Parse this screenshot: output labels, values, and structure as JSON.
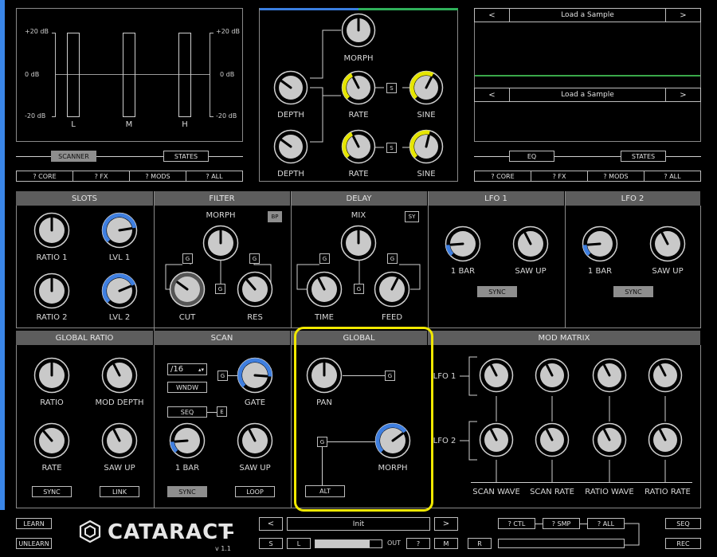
{
  "colors": {
    "accent_blue": "#3f7fe0",
    "accent_yellow": "#e6e600",
    "knob_fill": "#c9c9c9",
    "highlight": "#f0e800",
    "edge_bar": "#3a86e8",
    "scope_line": "#3aa84a"
  },
  "meters": {
    "scale_left": [
      "+20 dB",
      "0 dB",
      "-20 dB"
    ],
    "scale_right": [
      "+20 dB",
      "0 dB",
      "-20 dB"
    ],
    "bands": [
      "L",
      "M",
      "H"
    ],
    "tabs": {
      "scanner": "SCANNER",
      "states": "STATES"
    },
    "help": [
      "? CORE",
      "? FX",
      "? MODS",
      "? ALL"
    ]
  },
  "mod": {
    "labels": {
      "morph": "MORPH",
      "depth": "DEPTH",
      "rate": "RATE",
      "sine": "SINE",
      "s": "S"
    },
    "knobs": {
      "morph": 0.5,
      "depth1": 0.3,
      "rate1": 0.4,
      "sine1": 0.6,
      "depth2": 0.3,
      "rate2": 0.4,
      "sine2": 0.55
    }
  },
  "sampler": {
    "prev": "<",
    "next": ">",
    "slot1": "Load a Sample",
    "slot2": "Load a Sample",
    "tabs": {
      "eq": "EQ",
      "states": "STATES"
    },
    "help": [
      "? CORE",
      "? FX",
      "? MODS",
      "? ALL"
    ]
  },
  "slots": {
    "header": "SLOTS",
    "ratio1": "RATIO 1",
    "lvl1": "LVL 1",
    "ratio2": "RATIO 2",
    "lvl2": "LVL 2",
    "knobs": {
      "ratio1": 0.5,
      "lvl1": 0.8,
      "ratio2": 0.5,
      "lvl2": 0.75
    }
  },
  "filter": {
    "header": "FILTER",
    "morph": "MORPH",
    "bp": "BP",
    "cut": "CUT",
    "res": "RES",
    "g": "G",
    "knobs": {
      "morph": 0.5,
      "cut": 0.3,
      "res": 0.35
    }
  },
  "delay": {
    "header": "DELAY",
    "mix": "MIX",
    "sy": "SY",
    "time": "TIME",
    "feed": "FEED",
    "g": "G",
    "knobs": {
      "mix": 0.5,
      "time": 0.4,
      "feed": 0.6
    }
  },
  "lfo1": {
    "header": "LFO 1",
    "bar": "1 BAR",
    "saw": "SAW UP",
    "sync": "SYNC",
    "knobs": {
      "bar": 0.15,
      "saw": 0.4
    }
  },
  "lfo2": {
    "header": "LFO 2",
    "bar": "1 BAR",
    "saw": "SAW UP",
    "sync": "SYNC",
    "knobs": {
      "bar": 0.15,
      "saw": 0.4
    }
  },
  "global_ratio": {
    "header": "GLOBAL RATIO",
    "ratio": "RATIO",
    "mod_depth": "MOD DEPTH",
    "rate": "RATE",
    "saw": "SAW UP",
    "sync": "SYNC",
    "link": "LINK",
    "knobs": {
      "ratio": 0.5,
      "mod_depth": 0.4,
      "rate": 0.35,
      "saw": 0.4
    }
  },
  "scan": {
    "header": "SCAN",
    "division": "/16",
    "wndw": "WNDW",
    "g": "G",
    "gate": "GATE",
    "seq": "SEQ",
    "e": "E",
    "bar": "1 BAR",
    "saw": "SAW UP",
    "sync": "SYNC",
    "loop": "LOOP",
    "knobs": {
      "gate": 0.85,
      "bar": 0.15,
      "saw": 0.4
    }
  },
  "global": {
    "header": "GLOBAL",
    "pan": "PAN",
    "g": "G",
    "morph": "MORPH",
    "alt": "ALT",
    "knobs": {
      "pan": 0.5,
      "morph": 0.7
    }
  },
  "mod_matrix": {
    "header": "MOD MATRIX",
    "lfo1": "LFO 1",
    "lfo2": "LFO 2",
    "columns": [
      "SCAN WAVE",
      "SCAN RATE",
      "RATIO WAVE",
      "RATIO RATE"
    ]
  },
  "footer": {
    "learn": "LEARN",
    "unlearn": "UNLEARN",
    "logo": "CATARACT",
    "version": "v 1.1",
    "prev": "<",
    "next": ">",
    "preset": "Init",
    "s": "S",
    "l": "L",
    "out": "OUT",
    "help": "?",
    "m": "M",
    "r": "R",
    "ctl": "? CTL",
    "smp": "? SMP",
    "all": "? ALL",
    "seq": "SEQ",
    "rec": "REC"
  }
}
